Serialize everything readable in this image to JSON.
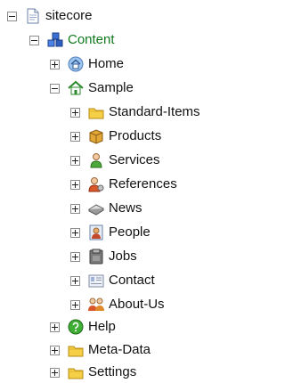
{
  "tree": {
    "root": {
      "label": "sitecore",
      "icon": "document-icon",
      "expanded": true
    },
    "content": {
      "label": "Content",
      "icon": "content-cubes-icon",
      "expanded": true,
      "selected": true,
      "selected_color": "#117a1c"
    },
    "home": {
      "label": "Home",
      "icon": "home-icon",
      "expanded": false
    },
    "sample": {
      "label": "Sample",
      "icon": "sample-house-icon",
      "expanded": true
    },
    "sample_children": [
      {
        "label": "Standard-Items",
        "icon": "folder-icon",
        "expanded": false
      },
      {
        "label": "Products",
        "icon": "package-icon",
        "expanded": false
      },
      {
        "label": "Services",
        "icon": "person-icon",
        "expanded": false
      },
      {
        "label": "References",
        "icon": "person-gear-icon",
        "expanded": false
      },
      {
        "label": "News",
        "icon": "newspaper-icon",
        "expanded": false
      },
      {
        "label": "People",
        "icon": "portrait-icon",
        "expanded": false
      },
      {
        "label": "Jobs",
        "icon": "briefcase-icon",
        "expanded": false
      },
      {
        "label": "Contact",
        "icon": "contact-card-icon",
        "expanded": false
      },
      {
        "label": "About-Us",
        "icon": "people-group-icon",
        "expanded": false
      }
    ],
    "content_children_after": [
      {
        "label": "Help",
        "icon": "help-icon",
        "expanded": false
      },
      {
        "label": "Meta-Data",
        "icon": "folder-icon",
        "expanded": false
      },
      {
        "label": "Settings",
        "icon": "folder-icon",
        "expanded": false
      }
    ]
  }
}
